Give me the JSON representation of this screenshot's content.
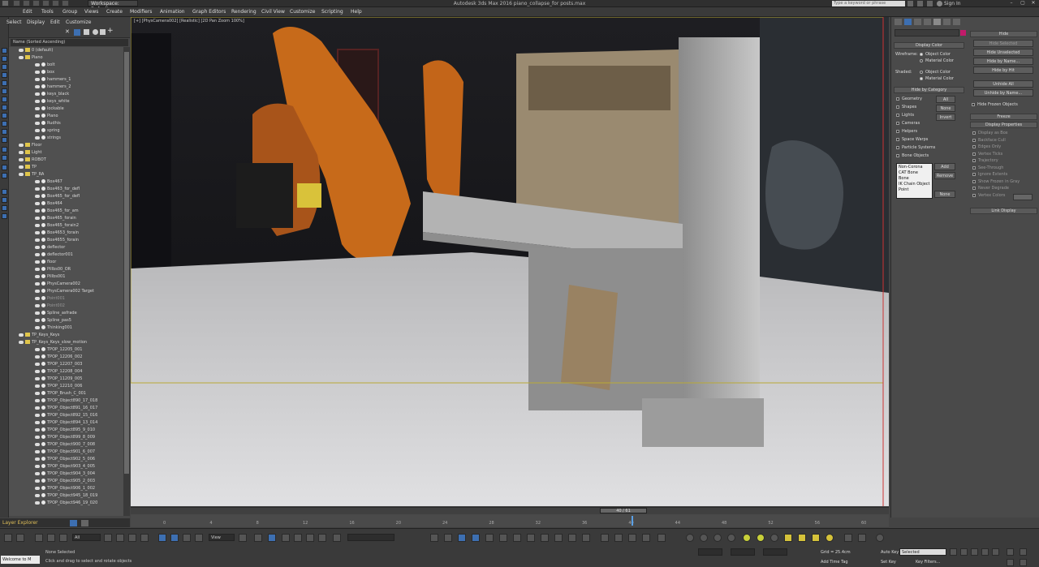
{
  "app": {
    "title": "Autodesk 3ds Max 2016    piano_collapse_for posts.max",
    "workspace": "Workspace: Default",
    "search_placeholder": "Type a keyword or phrase",
    "sign_in": "Sign In"
  },
  "menu": [
    "Edit",
    "Tools",
    "Group",
    "Views",
    "Create",
    "Modifiers",
    "Animation",
    "Graph Editors",
    "Rendering",
    "Civil View",
    "Customize",
    "Scripting",
    "Help"
  ],
  "scene_explorer": {
    "tabs": [
      "Select",
      "Display",
      "Edit",
      "Customize"
    ],
    "sort_header": "Name (Sorted Ascending)",
    "rows": [
      {
        "label": "0 (default)",
        "kind": "layer"
      },
      {
        "label": "Piano",
        "kind": "layer"
      },
      {
        "label": "bolt",
        "kind": "obj"
      },
      {
        "label": "box",
        "kind": "obj"
      },
      {
        "label": "hammers_1",
        "kind": "obj"
      },
      {
        "label": "hammers_2",
        "kind": "obj"
      },
      {
        "label": "keys_black",
        "kind": "obj"
      },
      {
        "label": "keys_white",
        "kind": "obj"
      },
      {
        "label": "lockable",
        "kind": "obj"
      },
      {
        "label": "Piano",
        "kind": "obj"
      },
      {
        "label": "Rudhis",
        "kind": "obj"
      },
      {
        "label": "spring",
        "kind": "obj"
      },
      {
        "label": "strings",
        "kind": "obj"
      },
      {
        "label": "Floor",
        "kind": "layer"
      },
      {
        "label": "Light",
        "kind": "layer"
      },
      {
        "label": "ROBOT",
        "kind": "layer"
      },
      {
        "label": "TP",
        "kind": "layer"
      },
      {
        "label": "TP_RA",
        "kind": "layer"
      },
      {
        "label": "Box467",
        "kind": "obj"
      },
      {
        "label": "Box463_for_defl",
        "kind": "obj"
      },
      {
        "label": "Box465_for_defl",
        "kind": "obj"
      },
      {
        "label": "Box464",
        "kind": "obj"
      },
      {
        "label": "Box465_for_am",
        "kind": "obj"
      },
      {
        "label": "Box465_forain",
        "kind": "obj"
      },
      {
        "label": "Box465_forain2",
        "kind": "obj"
      },
      {
        "label": "Box4653_forain",
        "kind": "obj"
      },
      {
        "label": "Box4655_forain",
        "kind": "obj"
      },
      {
        "label": "deflector",
        "kind": "obj"
      },
      {
        "label": "deflector001",
        "kind": "obj"
      },
      {
        "label": "floor",
        "kind": "obj"
      },
      {
        "label": "Pillbs00_OR",
        "kind": "obj"
      },
      {
        "label": "Pillbs001",
        "kind": "obj"
      },
      {
        "label": "PhysCamera002",
        "kind": "obj"
      },
      {
        "label": "PhysCamera002 Target",
        "kind": "obj"
      },
      {
        "label": "Point001",
        "kind": "dim"
      },
      {
        "label": "Point002",
        "kind": "dim"
      },
      {
        "label": "Spline_asfrade",
        "kind": "obj"
      },
      {
        "label": "Spline_pas5",
        "kind": "obj"
      },
      {
        "label": "Thinking001",
        "kind": "obj"
      },
      {
        "label": "TP_Keys_Keys",
        "kind": "layer"
      },
      {
        "label": "TP_Keys_Keys_slow_motion",
        "kind": "layer"
      },
      {
        "label": "TPOP_12205_001",
        "kind": "obj"
      },
      {
        "label": "TPOP_12206_002",
        "kind": "obj"
      },
      {
        "label": "TPOP_12207_003",
        "kind": "obj"
      },
      {
        "label": "TPOP_12208_004",
        "kind": "obj"
      },
      {
        "label": "TPOP_11209_005",
        "kind": "obj"
      },
      {
        "label": "TPOP_12210_006",
        "kind": "obj"
      },
      {
        "label": "TPOP_Brush_C_001",
        "kind": "obj"
      },
      {
        "label": "TPOP_Object890_17_018",
        "kind": "obj"
      },
      {
        "label": "TPOP_Object891_16_017",
        "kind": "obj"
      },
      {
        "label": "TPOP_Object892_15_016",
        "kind": "obj"
      },
      {
        "label": "TPOP_Object894_13_014",
        "kind": "obj"
      },
      {
        "label": "TPOP_Object895_9_010",
        "kind": "obj"
      },
      {
        "label": "TPOP_Object899_8_009",
        "kind": "obj"
      },
      {
        "label": "TPOP_Object900_7_008",
        "kind": "obj"
      },
      {
        "label": "TPOP_Object901_6_007",
        "kind": "obj"
      },
      {
        "label": "TPOP_Object902_5_006",
        "kind": "obj"
      },
      {
        "label": "TPOP_Object903_4_005",
        "kind": "obj"
      },
      {
        "label": "TPOP_Object904_3_004",
        "kind": "obj"
      },
      {
        "label": "TPOP_Object905_2_003",
        "kind": "obj"
      },
      {
        "label": "TPOP_Object906_1_002",
        "kind": "obj"
      },
      {
        "label": "TPOP_Object945_18_019",
        "kind": "obj"
      },
      {
        "label": "TPOP_Object946_19_020",
        "kind": "obj"
      }
    ],
    "layer_explorer": "Layer Explorer"
  },
  "viewport": {
    "label": "[+] [PhysCamera002] [Realistic] [2D Pan Zoom 100%]"
  },
  "command_panel": {
    "display_color_title": "Display Color",
    "wireframe_label": "Wireframe:",
    "shaded_label": "Shaded:",
    "object_color": "Object Color",
    "material_color": "Material Color",
    "hide_by_category_title": "Hide by Category",
    "categories": [
      "Geometry",
      "Shapes",
      "Lights",
      "Cameras",
      "Helpers",
      "Space Warps",
      "Particle Systems",
      "Bone Objects"
    ],
    "cat_buttons": [
      "All",
      "None",
      "Invert"
    ],
    "list_items": [
      "Non-Corona",
      "CAT Bone",
      "Bone",
      "IK Chain Object",
      "Point"
    ],
    "list_buttons": [
      "Add",
      "Remove",
      "None"
    ],
    "hide_title": "Hide",
    "hide_buttons": [
      "Hide Selected",
      "Hide Unselected",
      "Hide by Name...",
      "Hide by Hit",
      "Unhide All",
      "Unhide by Name..."
    ],
    "hide_frozen": "Hide Frozen Objects",
    "freeze_title": "Freeze",
    "display_props_title": "Display Properties",
    "display_props": [
      "Display as Box",
      "Backface Cull",
      "Edges Only",
      "Vertex Ticks",
      "Trajectory",
      "See-Through",
      "Ignore Extents",
      "Show Frozen in Gray",
      "Never Degrade",
      "Vertex Colors"
    ],
    "link_display_title": "Link Display"
  },
  "timeline": {
    "slider": "40 / 61",
    "ticks": [
      "0",
      "4",
      "8",
      "12",
      "16",
      "20",
      "24",
      "28",
      "32",
      "36",
      "40",
      "44",
      "48",
      "52",
      "56",
      "60"
    ]
  },
  "status": {
    "selection": "None Selected",
    "prompt": "Click and drag to select and rotate objects",
    "maxscript": "Welcome to M",
    "grid": "Grid = 25.4cm",
    "add_time_tag": "Add Time Tag",
    "auto_key": "Auto Key",
    "set_key": "Set Key",
    "selected": "Selected",
    "key_filters": "Key Filters..."
  },
  "toolbar": {
    "filter": "All",
    "view": "View"
  }
}
